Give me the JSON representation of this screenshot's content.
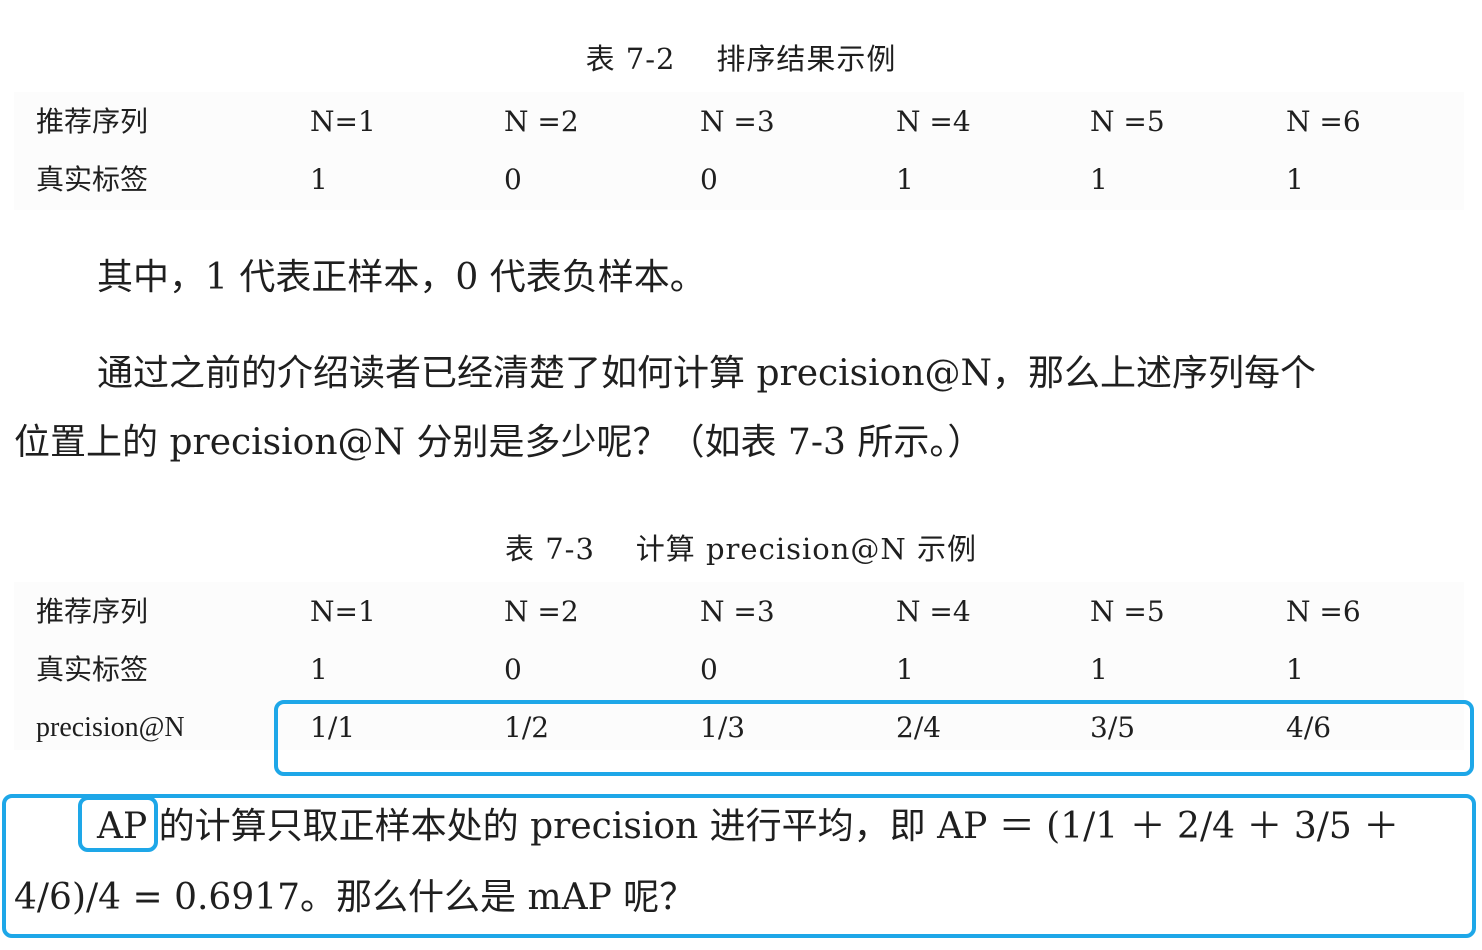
{
  "table1": {
    "caption": "表 7-2    排序结果示例",
    "rows": [
      {
        "label": "推荐序列",
        "cells": [
          "N=1",
          "N =2",
          "N =3",
          "N =4",
          "N =5",
          "N =6"
        ]
      },
      {
        "label": "真实标签",
        "cells": [
          "1",
          "0",
          "0",
          "1",
          "1",
          "1"
        ]
      }
    ]
  },
  "paragraph1": "其中，1 代表正样本，0 代表负样本。",
  "paragraph2": {
    "line1": "通过之前的介绍读者已经清楚了如何计算 precision@N，那么上述序列每个",
    "line2": "位置上的 precision@N 分别是多少呢？（如表 7-3 所示。）"
  },
  "table2": {
    "caption": "表 7-3    计算 precision@N 示例",
    "rows": [
      {
        "label": "推荐序列",
        "cells": [
          "N=1",
          "N =2",
          "N =3",
          "N =4",
          "N =5",
          "N =6"
        ]
      },
      {
        "label": "真实标签",
        "cells": [
          "1",
          "0",
          "0",
          "1",
          "1",
          "1"
        ]
      },
      {
        "label": "precision@N",
        "cells": [
          "1/1",
          "1/2",
          "1/3",
          "2/4",
          "3/5",
          "4/6"
        ]
      }
    ]
  },
  "paragraph3": {
    "line1": "AP 的计算只取正样本处的 precision 进行平均，即 AP ＝ (1/1 ＋ 2/4 ＋ 3/5 ＋",
    "line2": "4/6)/4 = 0.6917。那么什么是 mAP 呢？"
  },
  "colors": {
    "highlight": "#1ea7e8",
    "text": "#1f1f1f",
    "table_bg": "#fcfcfc"
  }
}
